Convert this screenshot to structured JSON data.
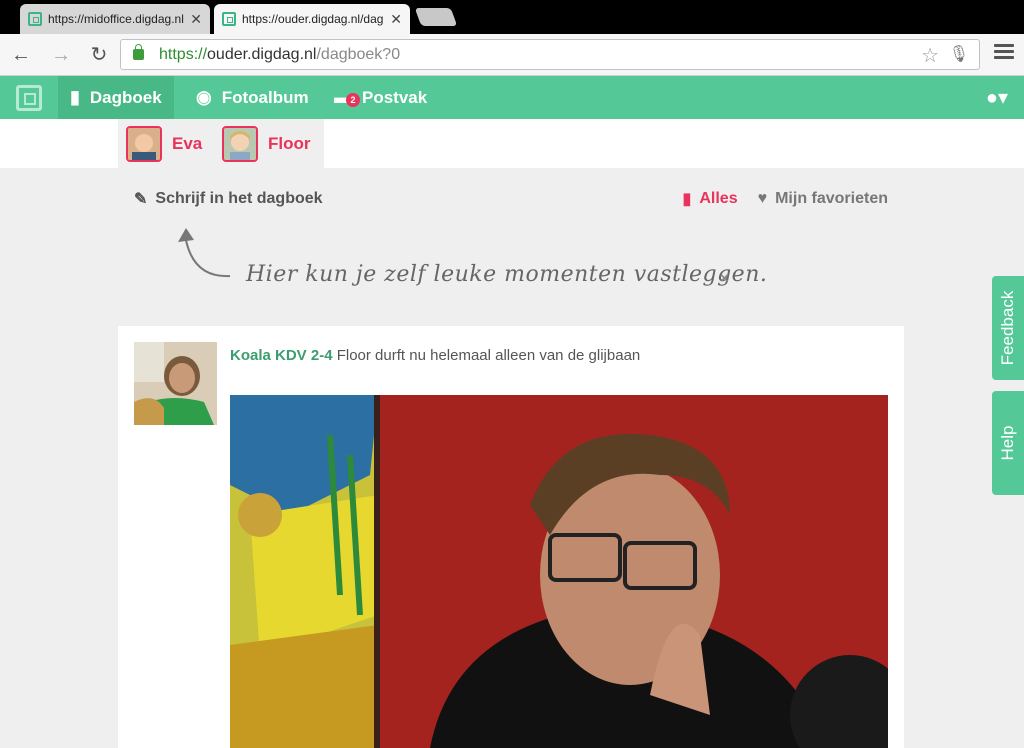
{
  "browser": {
    "tabs": [
      {
        "title": "https://midoffice.digdag.nl/"
      },
      {
        "title": "https://ouder.digdag.nl/dagboek"
      }
    ],
    "url": {
      "scheme": "https://",
      "host": "ouder.digdag.nl",
      "path": "/dagboek?0"
    }
  },
  "nav": {
    "items": [
      {
        "label": "Dagboek",
        "icon": "notebook-icon"
      },
      {
        "label": "Fotoalbum",
        "icon": "camera-icon"
      },
      {
        "label": "Postvak",
        "icon": "chat-icon",
        "badge": "2"
      }
    ]
  },
  "children": [
    {
      "name": "Eva"
    },
    {
      "name": "Floor"
    }
  ],
  "actions": {
    "write_label": "Schrijf in het dagboek",
    "filter_all": "Alles",
    "filter_favorites": "Mijn favorieten"
  },
  "hint": {
    "text": "Hier kun je zelf leuke momenten vastleggen.",
    "close": "×"
  },
  "post": {
    "group": "Koala KDV 2-4",
    "text": "Floor durft nu helemaal alleen van de glijbaan"
  },
  "side": {
    "feedback": "Feedback",
    "help": "Help"
  },
  "colors": {
    "brand_green": "#54c896",
    "accent_pink": "#e8335c"
  }
}
